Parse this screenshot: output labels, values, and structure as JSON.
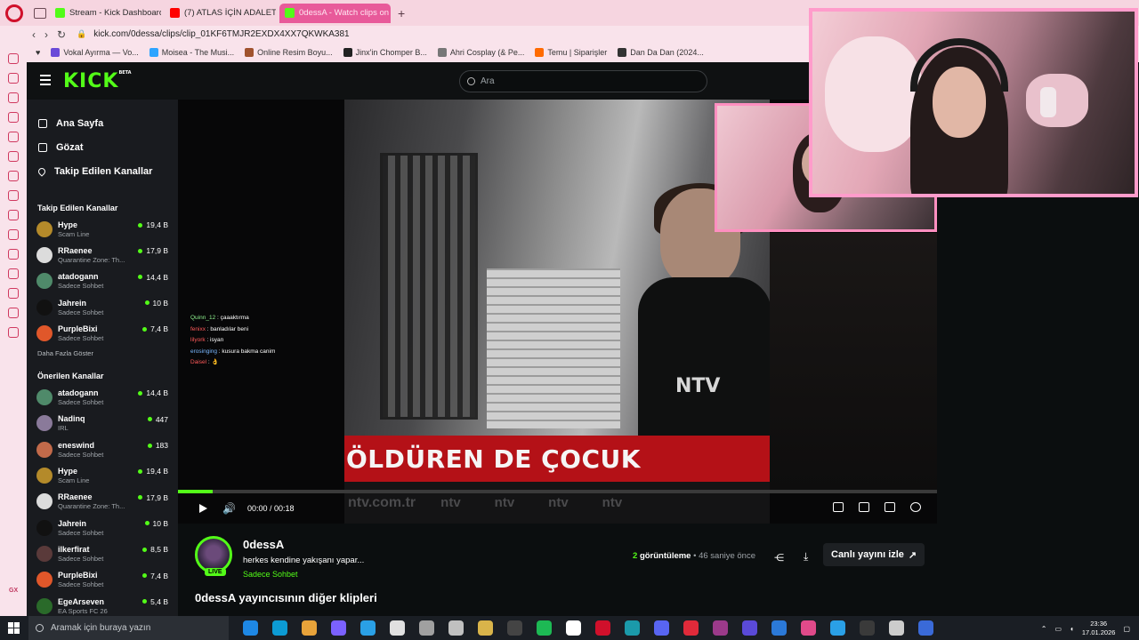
{
  "browser": {
    "tabs": [
      {
        "label": "Stream - Kick Dashboard",
        "color": "#53fc18",
        "active": false
      },
      {
        "label": "(7) ATLAS İÇİN ADALET",
        "color": "#ff0000",
        "active": false
      },
      {
        "label": "0dessA - Watch clips on K",
        "color": "#53fc18",
        "active": true
      }
    ],
    "new_tab": "+",
    "url": "kick.com/0dessa/clips/clip_01KF6TMJR2EXDX4XX7QKWKA381",
    "bookmarks": [
      {
        "label": "Vokal Ayırma — Vo...",
        "color": "#6a4ad8"
      },
      {
        "label": "Moisea - The Musi...",
        "color": "#2ea4ff"
      },
      {
        "label": "Online Resim Boyu...",
        "color": "#a0522d"
      },
      {
        "label": "Jinx'in Chomper B...",
        "color": "#222222"
      },
      {
        "label": "Ahri Cosplay (& Pe...",
        "color": "#777777"
      },
      {
        "label": "Temu | Siparişler",
        "color": "#ff6a00"
      },
      {
        "label": "Dan Da Dan (2024...",
        "color": "#333333"
      }
    ],
    "gx_label": "GX"
  },
  "kick": {
    "logo": "KICK",
    "logo_badge": "BETA",
    "search_placeholder": "Ara",
    "nav": [
      {
        "label": "Ana Sayfa",
        "icon": "home-icon"
      },
      {
        "label": "Gözat",
        "icon": "browse-icon"
      },
      {
        "label": "Takip Edilen Kanallar",
        "icon": "heart-icon"
      }
    ],
    "followed_title": "Takip Edilen Kanallar",
    "followed": [
      {
        "name": "Hype",
        "category": "Scam Line",
        "viewers": "19,4 B",
        "color": "#b48a2a"
      },
      {
        "name": "RRaenee",
        "category": "Quarantine Zone: Th...",
        "viewers": "17,9 B",
        "color": "#dcdcdc"
      },
      {
        "name": "atadogann",
        "category": "Sadece Sohbet",
        "viewers": "14,4 B",
        "color": "#4f8a6a"
      },
      {
        "name": "Jahrein",
        "category": "Sadece Sohbet",
        "viewers": "10 B",
        "color": "#111111"
      },
      {
        "name": "PurpleBixi",
        "category": "Sadece Sohbet",
        "viewers": "7,4 B",
        "color": "#e0572a"
      }
    ],
    "show_more": "Daha Fazla Göster",
    "recommended_title": "Önerilen Kanallar",
    "recommended": [
      {
        "name": "atadogann",
        "category": "Sadece Sohbet",
        "viewers": "14,4 B",
        "color": "#4f8a6a"
      },
      {
        "name": "Nadinq",
        "category": "IRL",
        "viewers": "447",
        "color": "#8a7a9a"
      },
      {
        "name": "eneswind",
        "category": "Sadece Sohbet",
        "viewers": "183",
        "color": "#c26a4a"
      },
      {
        "name": "Hype",
        "category": "Scam Line",
        "viewers": "19,4 B",
        "color": "#b48a2a"
      },
      {
        "name": "RRaenee",
        "category": "Quarantine Zone: Th...",
        "viewers": "17,9 B",
        "color": "#dcdcdc"
      },
      {
        "name": "Jahrein",
        "category": "Sadece Sohbet",
        "viewers": "10 B",
        "color": "#111111"
      },
      {
        "name": "ilkerfirat",
        "category": "Sadece Sohbet",
        "viewers": "8,5 B",
        "color": "#5a3a3a"
      },
      {
        "name": "PurpleBixi",
        "category": "Sadece Sohbet",
        "viewers": "7,4 B",
        "color": "#e0572a"
      },
      {
        "name": "EgeArseven",
        "category": "EA Sports FC 26",
        "viewers": "5,4 B",
        "color": "#2a6a2a"
      }
    ]
  },
  "video": {
    "lower_third": "ÖLDÜREN DE ÇOCUK",
    "ticker_domain": "ntv.com.tr",
    "ticker_items": [
      "ntv",
      "ntv",
      "ntv",
      "ntv"
    ],
    "ntv_logo": "NTV",
    "overlay_chat": [
      {
        "user": "Quinn_12",
        "msg": "çaaaktırma",
        "cls": "u1"
      },
      {
        "user": "fenixx",
        "msg": "banladılar beni",
        "cls": "u2"
      },
      {
        "user": "lilyork",
        "msg": "isyan",
        "cls": "u2"
      },
      {
        "user": "erosinging",
        "msg": "kusura bakma canim",
        "cls": "u3"
      },
      {
        "user": "Daisel",
        "msg": "👌",
        "cls": "u2"
      }
    ],
    "progress": 0.046,
    "time_current": "00:00",
    "time_sep": "/",
    "time_total": "00:18"
  },
  "clip": {
    "channel": "0dessA",
    "live_badge": "LIVE",
    "title": "herkes kendine yakışanı yapar...",
    "category": "Sadece Sohbet",
    "views_count": "2",
    "views_label": "görüntüleme",
    "ago": "• 46 saniye önce",
    "watch_live": "Canlı yayını izle",
    "more_clips": "0dessA yayıncısının diğer klipleri"
  },
  "taskbar": {
    "search_placeholder": "Aramak için buraya yazın",
    "apps": [
      "#1e88e5",
      "#0c9bd4",
      "#e8a33a",
      "#7b61ff",
      "#2aa0e6",
      "#e0e0e0",
      "#a0a0a0",
      "#c0c0c0",
      "#d9b44a",
      "#444444",
      "#1db954",
      "#ffffff",
      "#d0102b",
      "#1b9aaa",
      "#5865f2",
      "#e02a3a",
      "#9b3a8a",
      "#5a4ad8",
      "#2b79d8",
      "#e04a8a",
      "#2aa0e6",
      "#3a3a3a",
      "#cccccc",
      "#3a6ad8"
    ],
    "time": "23:36",
    "date": "17.01.2026"
  }
}
